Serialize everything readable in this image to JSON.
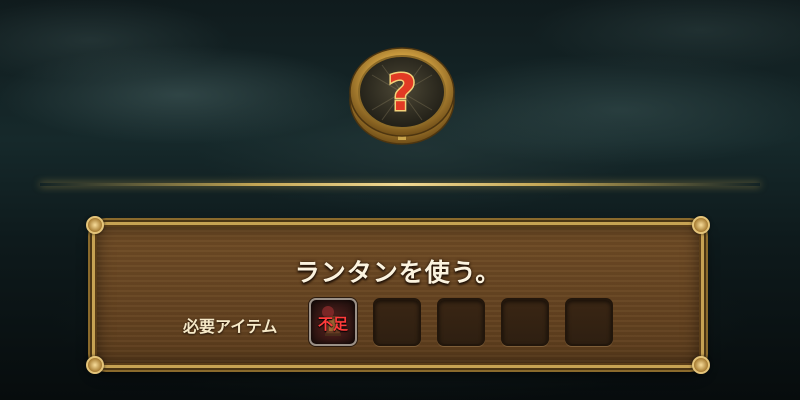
{
  "dialog": {
    "message": "ランタンを使う。",
    "required_items_label": "必要アイテム"
  },
  "medal": {
    "icon": "question-mark-icon",
    "symbol": "?"
  },
  "required_items": [
    {
      "icon": "lantern-icon",
      "status": "不足"
    },
    {
      "icon": "empty-slot"
    },
    {
      "icon": "empty-slot"
    },
    {
      "icon": "empty-slot"
    },
    {
      "icon": "empty-slot"
    }
  ],
  "colors": {
    "panel_wood": "#664421",
    "panel_border": "#c6a253",
    "text": "#fbf3df",
    "shortage_text": "#ff3b3b",
    "question_mark": "#e23a24"
  }
}
